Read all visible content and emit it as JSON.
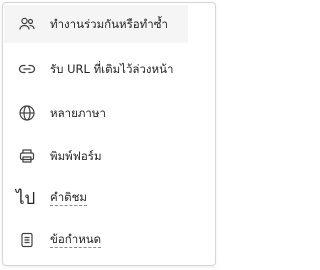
{
  "menu": {
    "items": [
      {
        "label": "ทำงานร่วมกันหรือทำซ้ำ",
        "icon": "people-icon",
        "active": true
      },
      {
        "label": "รับ URL ที่เติมไว้ล่วงหน้า",
        "icon": "link-icon"
      },
      {
        "label": "หลายภาษา",
        "icon": "globe-icon"
      },
      {
        "label": "พิมพ์ฟอร์ม",
        "icon": "printer-icon"
      },
      {
        "label": "คำติชม",
        "icon": "feedback-icon",
        "icon_text": "ไป"
      },
      {
        "label": "ข้อกำหนด",
        "icon": "document-icon"
      }
    ]
  }
}
